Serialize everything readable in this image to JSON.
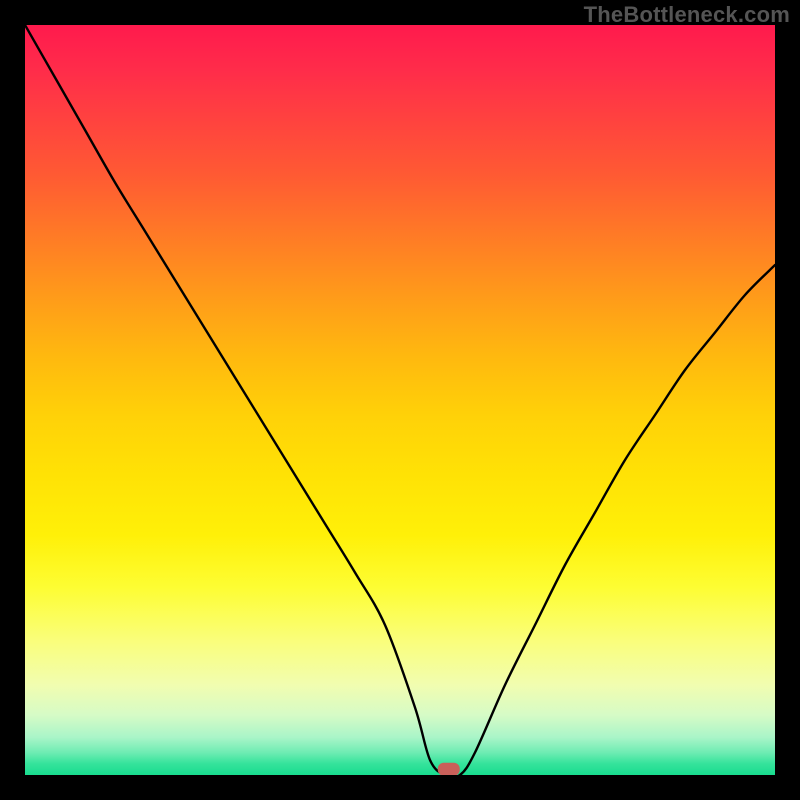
{
  "watermark": "TheBottleneck.com",
  "colors": {
    "frame": "#000000",
    "curve": "#000000",
    "marker": "#c9605a",
    "gradient_stops": [
      "#ff1a4d",
      "#ff2c4a",
      "#ff4040",
      "#ff5a33",
      "#ff7a26",
      "#ff9a1a",
      "#ffb80f",
      "#ffd108",
      "#ffe205",
      "#fff008",
      "#fdfd33",
      "#fafe7a",
      "#f1fdb0",
      "#d6fbc6",
      "#a9f5c8",
      "#6eecb3",
      "#35e39b",
      "#18dc8f"
    ]
  },
  "chart_data": {
    "type": "line",
    "title": "",
    "xlabel": "",
    "ylabel": "",
    "xlim": [
      0,
      100
    ],
    "ylim": [
      0,
      100
    ],
    "grid": false,
    "description": "Bottleneck-style V curve; y is bottleneck percentage (lower is better), minimum near x≈56 where the marker sits.",
    "x": [
      0,
      4,
      8,
      12,
      16,
      20,
      24,
      28,
      32,
      36,
      40,
      44,
      48,
      52,
      54,
      56,
      58,
      60,
      64,
      68,
      72,
      76,
      80,
      84,
      88,
      92,
      96,
      100
    ],
    "y": [
      100,
      93,
      86,
      79,
      72.5,
      66,
      59.5,
      53,
      46.5,
      40,
      33.5,
      27,
      20,
      9,
      2,
      0,
      0,
      3,
      12,
      20,
      28,
      35,
      42,
      48,
      54,
      59,
      64,
      68
    ],
    "marker": {
      "x": 56.5,
      "y": 0.5
    }
  }
}
